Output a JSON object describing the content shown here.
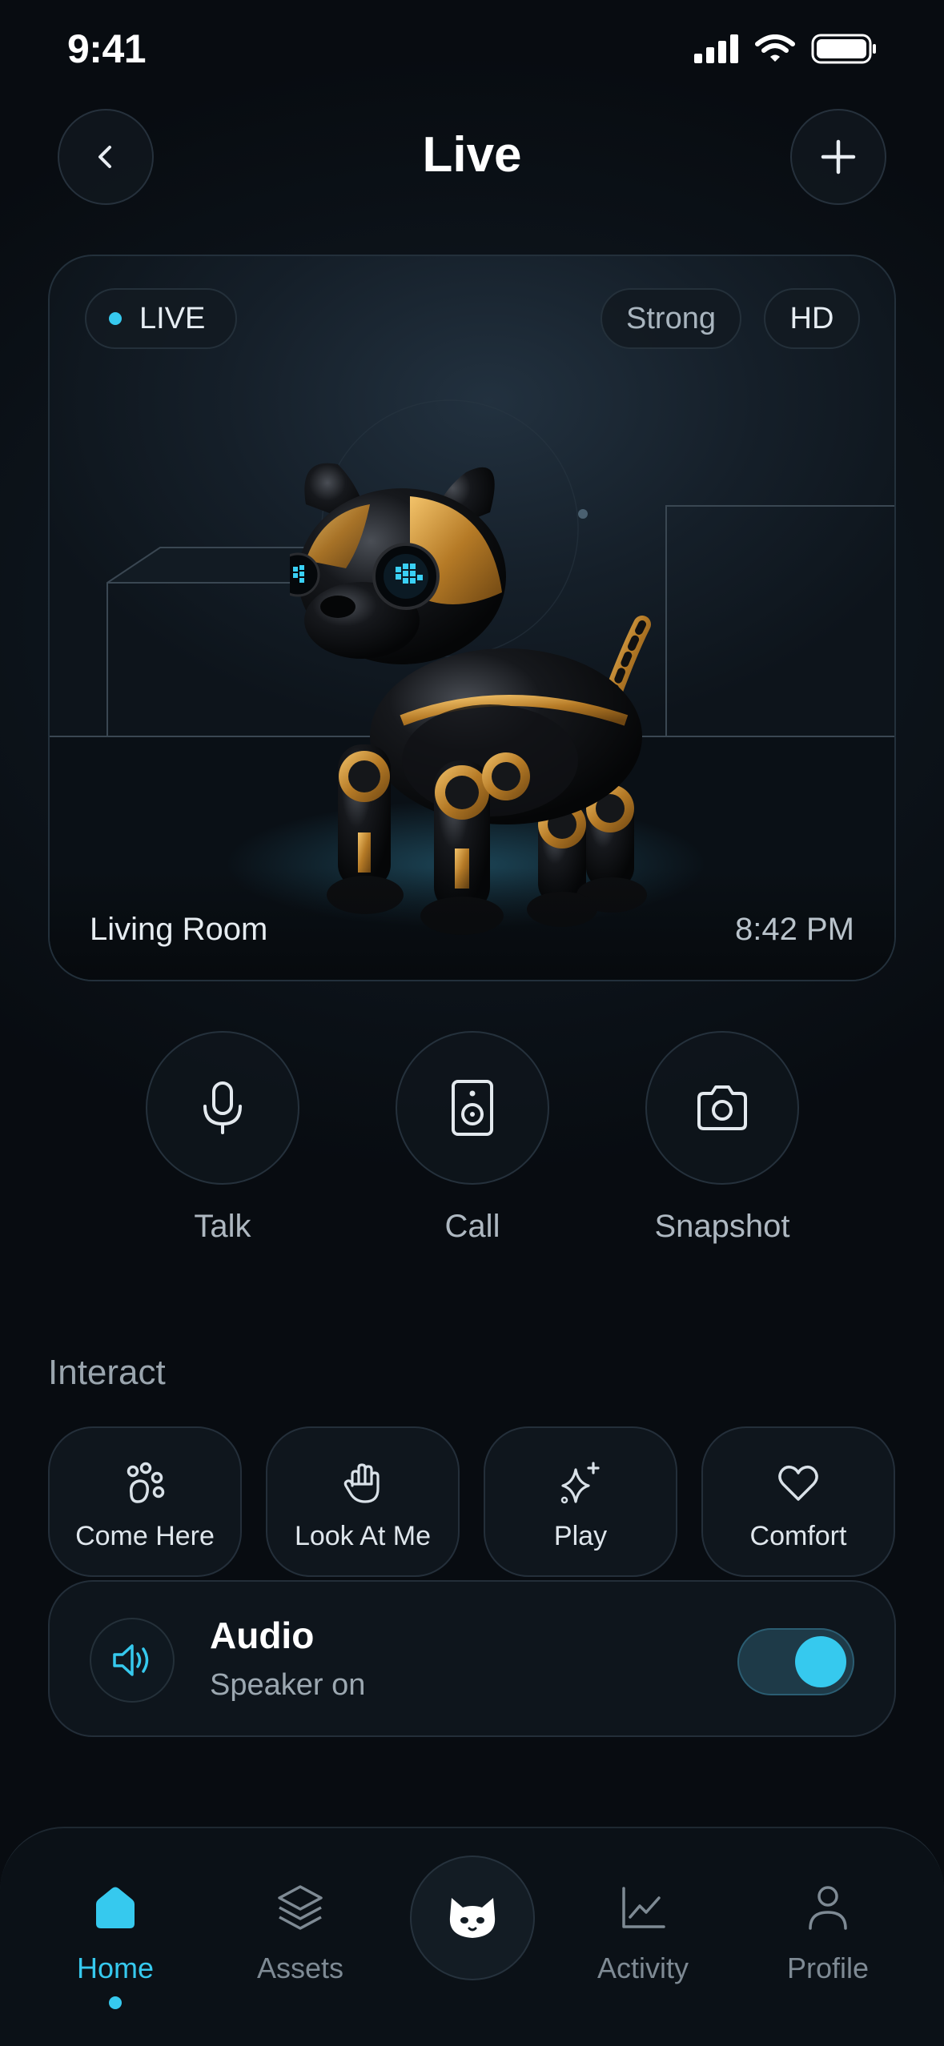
{
  "status_bar": {
    "time": "9:41"
  },
  "header": {
    "title": "Live"
  },
  "live_card": {
    "live_badge": "LIVE",
    "signal": "Strong",
    "quality": "HD",
    "room": "Living Room",
    "time": "8:42 PM"
  },
  "quick_actions": [
    {
      "label": "Talk",
      "icon": "microphone-icon"
    },
    {
      "label": "Call",
      "icon": "speaker-device-icon"
    },
    {
      "label": "Snapshot",
      "icon": "camera-icon"
    }
  ],
  "interact": {
    "title": "Interact",
    "items": [
      {
        "label": "Come Here",
        "icon": "paw-icon"
      },
      {
        "label": "Look At Me",
        "icon": "hand-icon"
      },
      {
        "label": "Play",
        "icon": "sparkle-icon"
      },
      {
        "label": "Comfort",
        "icon": "heart-icon"
      }
    ]
  },
  "audio": {
    "title": "Audio",
    "subtitle": "Speaker on",
    "enabled": true
  },
  "nav": {
    "items": [
      {
        "label": "Home",
        "active": true
      },
      {
        "label": "Assets"
      },
      {
        "label": "Activity"
      },
      {
        "label": "Profile"
      }
    ]
  },
  "colors": {
    "accent": "#36c9ee",
    "background": "#0b1016"
  }
}
